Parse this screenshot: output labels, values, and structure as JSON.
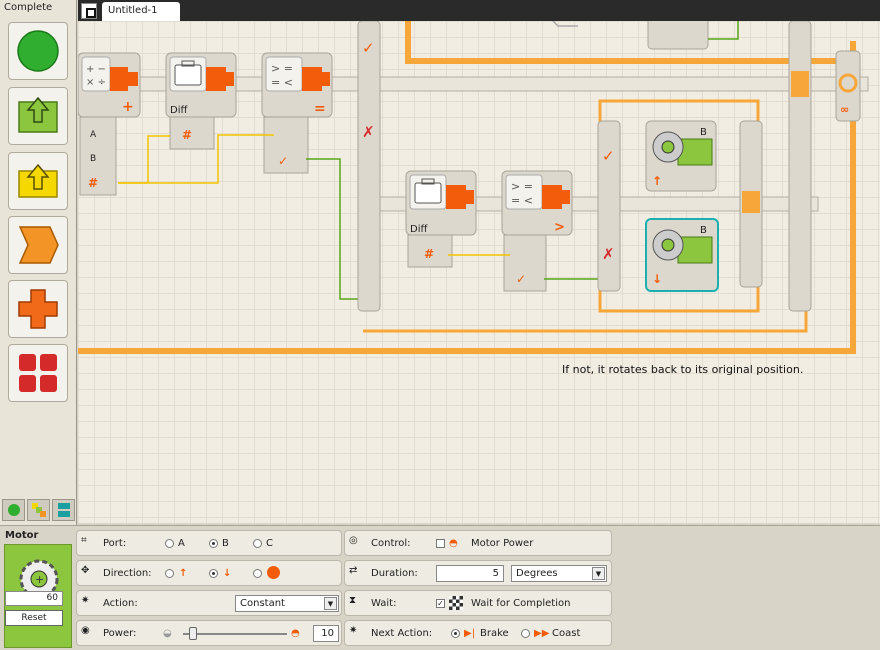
{
  "palette": {
    "title": "Complete",
    "items": [
      {
        "name": "common-blocks",
        "color": "#2fae2f"
      },
      {
        "name": "action-blocks",
        "color": "#8cc63e"
      },
      {
        "name": "sensor-blocks",
        "color": "#f4d800"
      },
      {
        "name": "flow-blocks",
        "color": "#f07f1a"
      },
      {
        "name": "data-blocks",
        "color": "#f06a1a"
      },
      {
        "name": "advanced-blocks",
        "color": "#d42a2a"
      }
    ]
  },
  "document": {
    "tab_title": "Untitled-1"
  },
  "canvas": {
    "note": "If not, it rotates back to its original position.",
    "blocks": {
      "math_label": "",
      "diff_label_1": "Diff",
      "diff_label_2": "Diff",
      "motor_port_top": "B",
      "motor_port_bottom": "B",
      "plug_a": "A",
      "plug_b": "B"
    }
  },
  "config": {
    "block_title": "Motor",
    "block_value": "60",
    "reset_label": "Reset",
    "port": {
      "label": "Port:",
      "options": [
        "A",
        "B",
        "C"
      ],
      "selected": "B"
    },
    "direction": {
      "label": "Direction:",
      "selected": "backward"
    },
    "action": {
      "label": "Action:",
      "value": "Constant"
    },
    "power": {
      "label": "Power:",
      "value": "10"
    },
    "control": {
      "label": "Control:",
      "option": "Motor Power",
      "checked": false
    },
    "duration": {
      "label": "Duration:",
      "value": "5",
      "unit": "Degrees"
    },
    "wait": {
      "label": "Wait:",
      "option": "Wait for Completion",
      "checked": true
    },
    "next_action": {
      "label": "Next Action:",
      "options": [
        "Brake",
        "Coast"
      ],
      "selected": "Brake"
    }
  }
}
